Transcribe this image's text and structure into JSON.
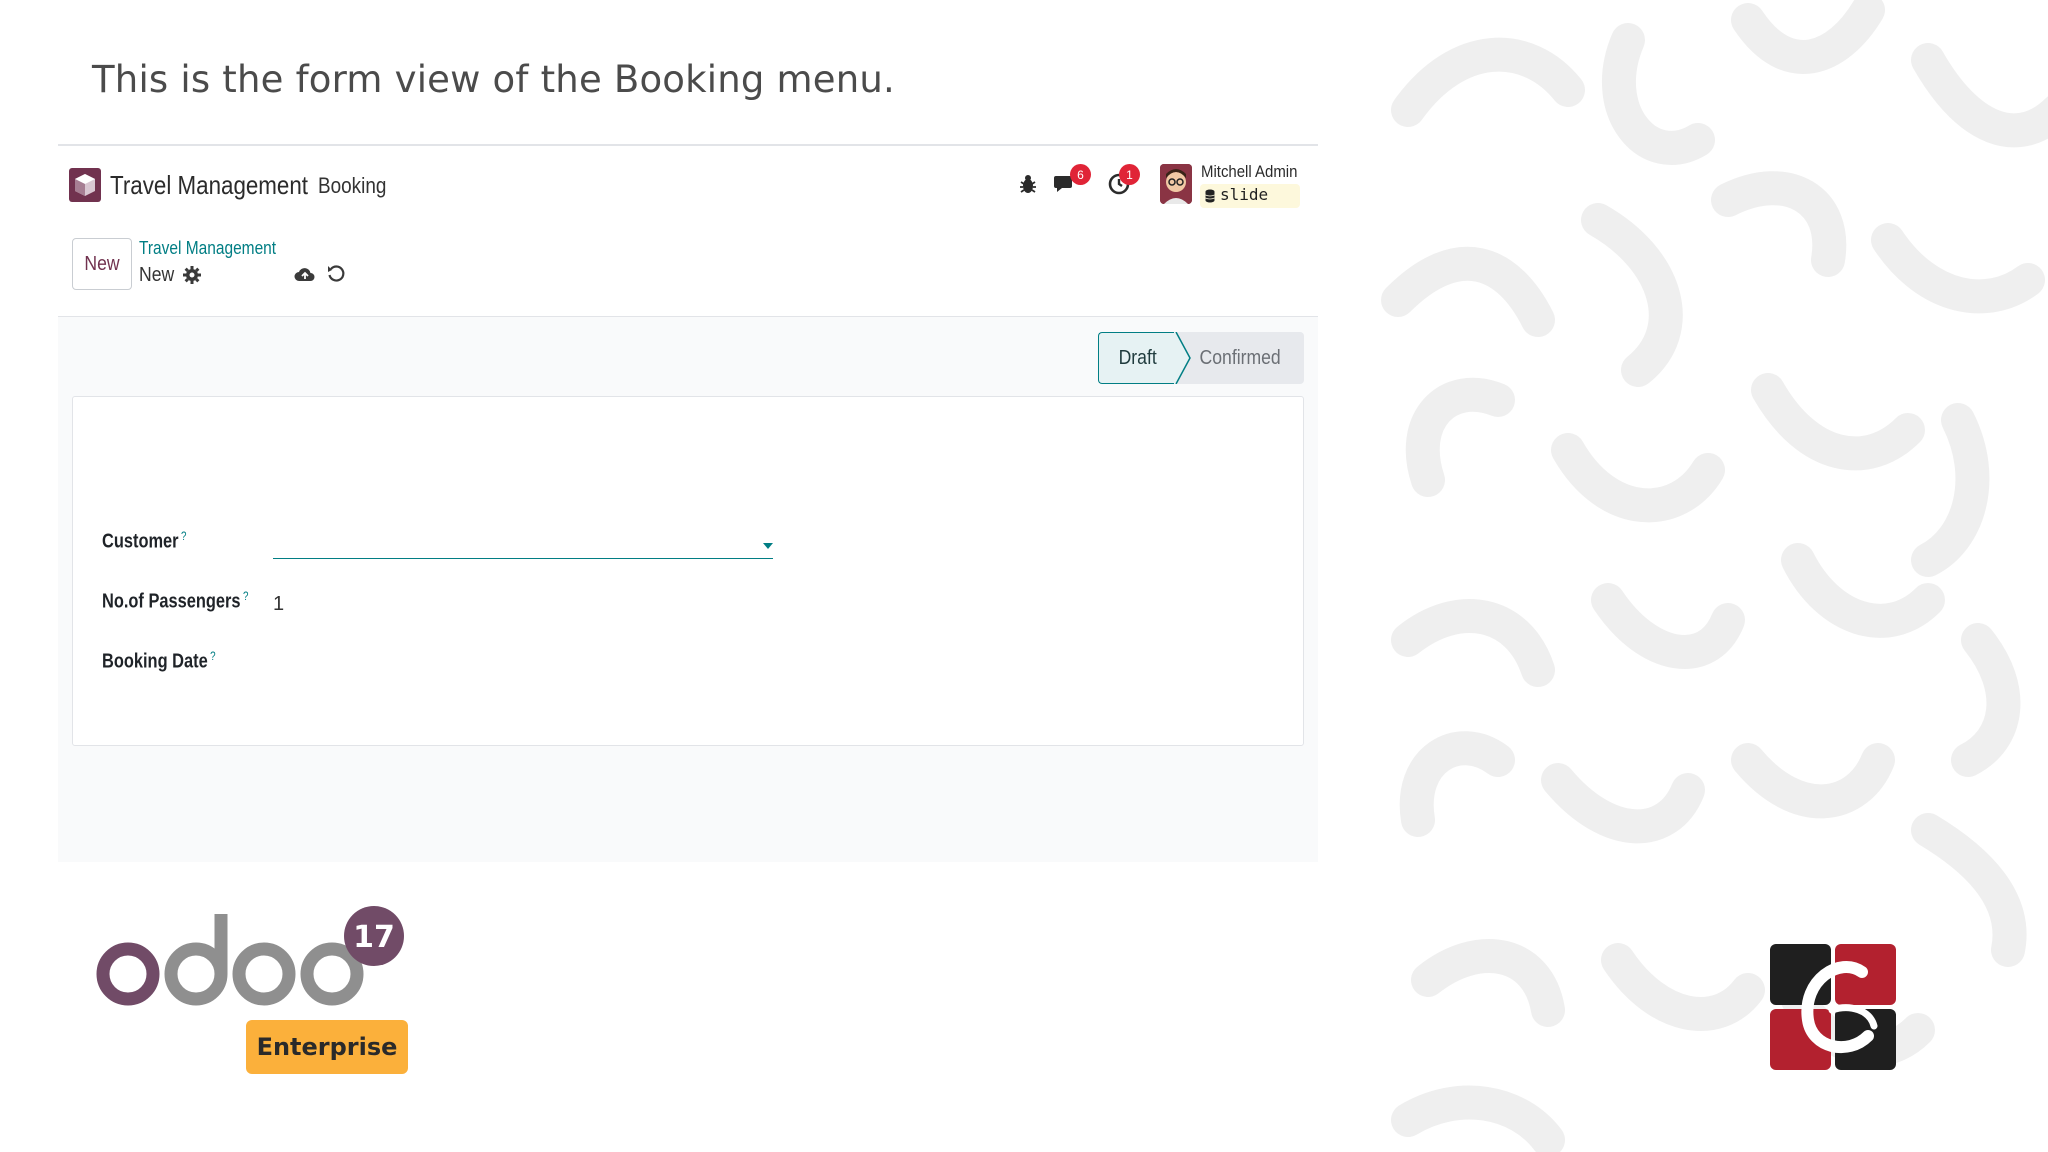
{
  "slide": {
    "title": "This is the form view of the Booking menu."
  },
  "navbar": {
    "app_name": "Travel Management",
    "menu_item": "Booking",
    "messages_count": "6",
    "activities_count": "1",
    "user_name": "Mitchell Admin",
    "database": "slide"
  },
  "control_panel": {
    "new_button": "New",
    "breadcrumb": "Travel Management",
    "record_name": "New"
  },
  "statusbar": {
    "stages": [
      "Draft",
      "Confirmed"
    ],
    "active_stage": "Draft"
  },
  "form": {
    "fields": [
      {
        "label": "Customer",
        "help": "?",
        "value": ""
      },
      {
        "label": "No.of Passengers",
        "help": "?",
        "value": "1"
      },
      {
        "label": "Booking Date",
        "help": "?",
        "value": ""
      }
    ]
  },
  "brand": {
    "version": "17",
    "edition": "Enterprise"
  },
  "colors": {
    "primary": "#71324f",
    "accent": "#017e84",
    "badge": "#e02437",
    "enterprise": "#fbb03b"
  }
}
